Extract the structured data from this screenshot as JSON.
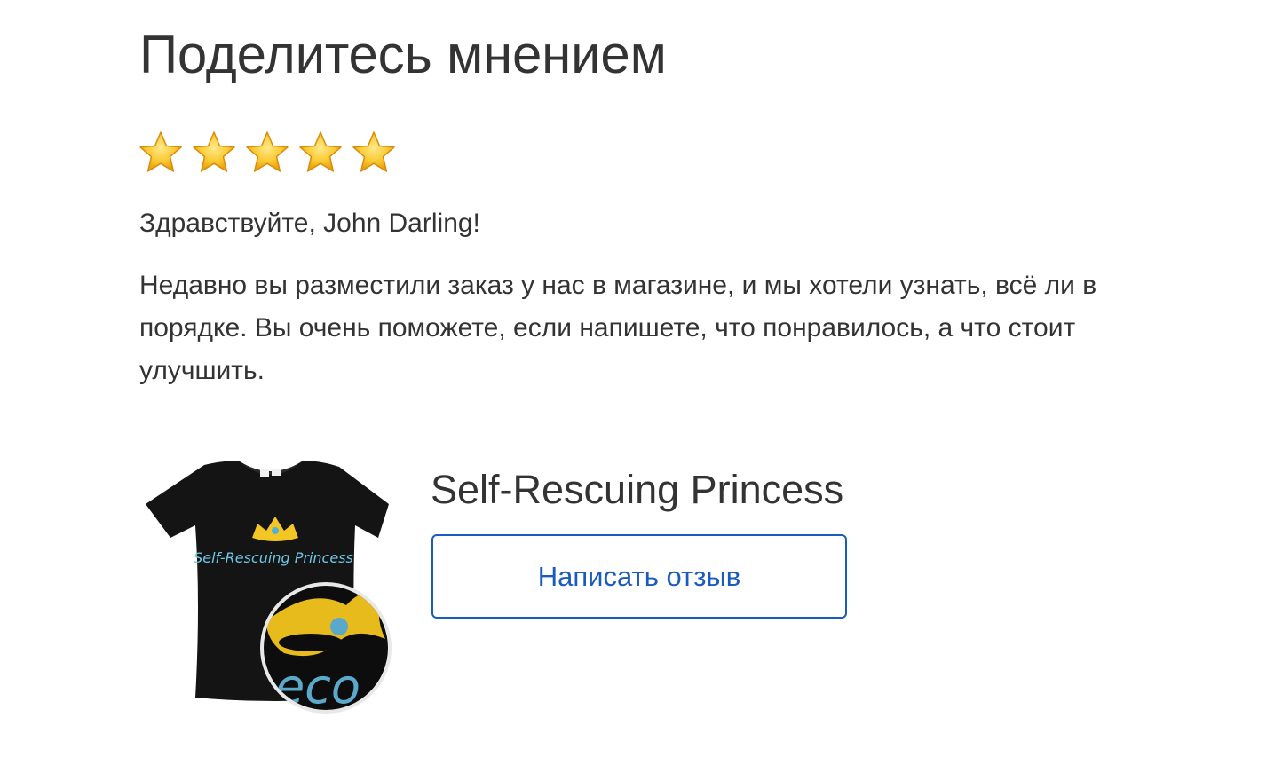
{
  "header": {
    "title": "Поделитесь мнением"
  },
  "rating": {
    "stars": 5,
    "max": 5,
    "icon": "star-icon",
    "color": "#f7c431"
  },
  "greeting": "Здравствуйте, John Darling!",
  "message": "Недавно вы разместили заказ у нас в магазине, и мы хотели узнать, всё ли в порядке. Вы очень поможете, если напишете, что понравилось, а что стоит улучшить.",
  "product": {
    "name": "Self-Rescuing Princess",
    "image_text": "Self-Rescuing Princess",
    "review_button_label": "Написать отзыв"
  },
  "colors": {
    "accent": "#1a5bbe",
    "text": "#333333"
  }
}
